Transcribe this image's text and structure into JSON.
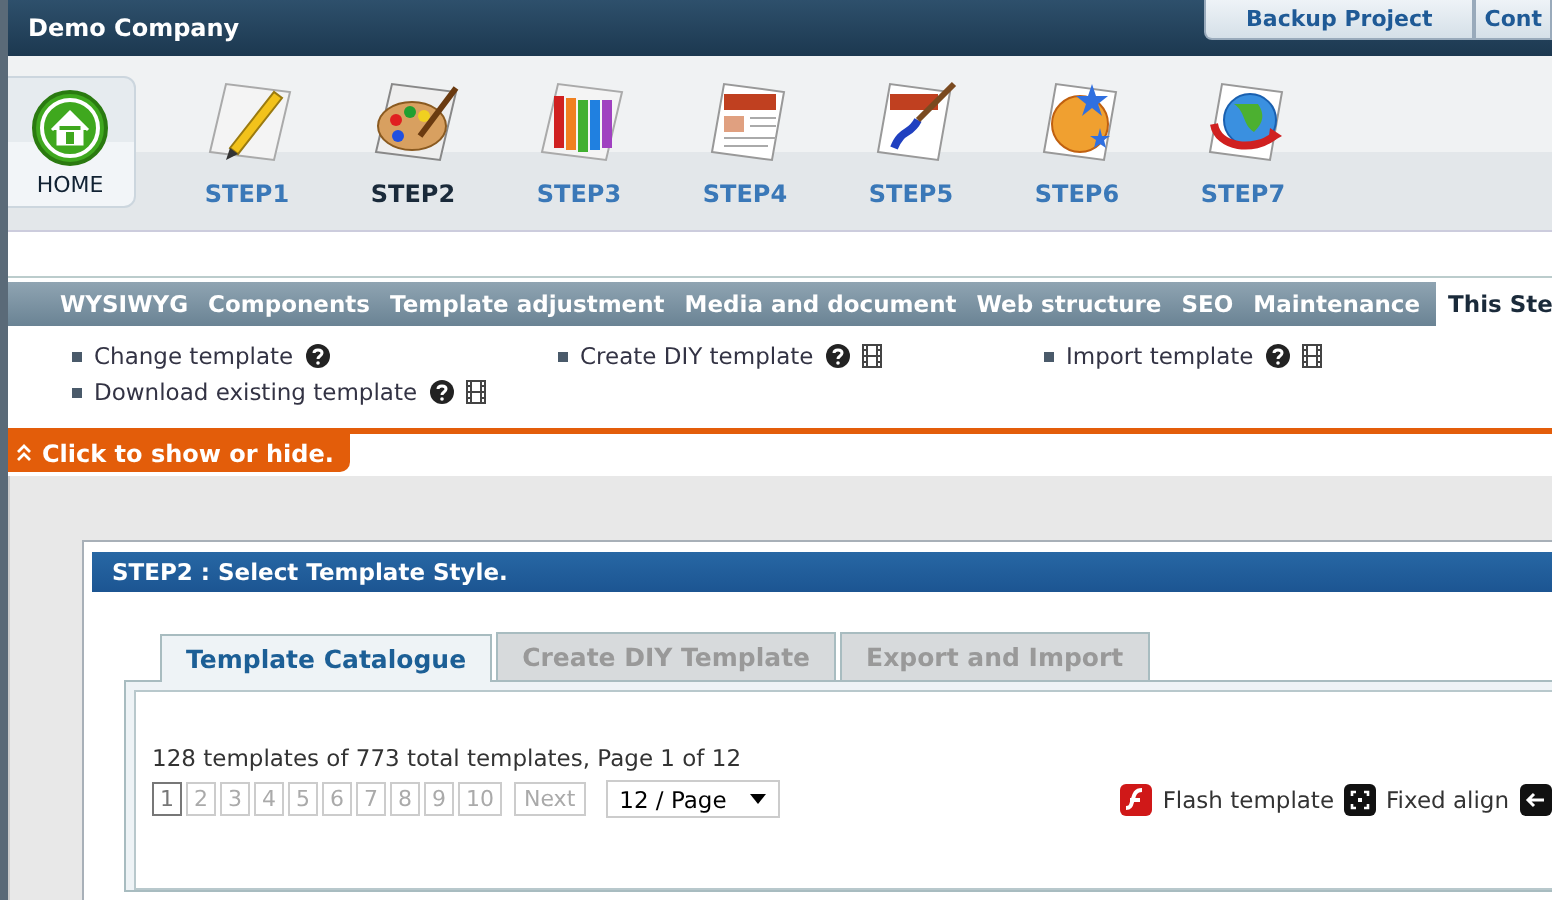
{
  "header": {
    "title": "Demo Company",
    "tabs": [
      "Backup Project",
      "Cont"
    ]
  },
  "home": {
    "label": "HOME"
  },
  "steps": [
    {
      "label": "STEP1",
      "selected": false,
      "kind": "pencil"
    },
    {
      "label": "STEP2",
      "selected": true,
      "kind": "palette"
    },
    {
      "label": "STEP3",
      "selected": false,
      "kind": "swatch"
    },
    {
      "label": "STEP4",
      "selected": false,
      "kind": "document"
    },
    {
      "label": "STEP5",
      "selected": false,
      "kind": "brush"
    },
    {
      "label": "STEP6",
      "selected": false,
      "kind": "stars"
    },
    {
      "label": "STEP7",
      "selected": false,
      "kind": "globe"
    }
  ],
  "menu": [
    {
      "label": "WYSIWYG",
      "selected": false
    },
    {
      "label": "Components",
      "selected": false
    },
    {
      "label": "Template adjustment",
      "selected": false
    },
    {
      "label": "Media and document",
      "selected": false
    },
    {
      "label": "Web structure",
      "selected": false
    },
    {
      "label": "SEO",
      "selected": false
    },
    {
      "label": "Maintenance",
      "selected": false
    },
    {
      "label": "This Ste",
      "selected": true
    }
  ],
  "links": [
    {
      "label": "Change template",
      "help": true,
      "video": false
    },
    {
      "label": "Create DIY template",
      "help": true,
      "video": true
    },
    {
      "label": "Import template",
      "help": true,
      "video": true
    },
    {
      "label": "Download existing template",
      "help": true,
      "video": true
    }
  ],
  "toggle": {
    "label": "Click to show or hide."
  },
  "panel": {
    "title": "STEP2 : Select Template Style.",
    "tabs": [
      {
        "label": "Template Catalogue",
        "selected": true
      },
      {
        "label": "Create DIY Template",
        "selected": false
      },
      {
        "label": "Export and Import",
        "selected": false
      }
    ],
    "summary": "128 templates of 773 total templates, Page 1 of 12",
    "pages": [
      {
        "label": "1",
        "selected": true
      },
      {
        "label": "2",
        "selected": false
      },
      {
        "label": "3",
        "selected": false
      },
      {
        "label": "4",
        "selected": false
      },
      {
        "label": "5",
        "selected": false
      },
      {
        "label": "6",
        "selected": false
      },
      {
        "label": "7",
        "selected": false
      },
      {
        "label": "8",
        "selected": false
      },
      {
        "label": "9",
        "selected": false
      },
      {
        "label": "10",
        "selected": false
      }
    ],
    "next": "Next",
    "per_page": "12 / Page",
    "legend": [
      {
        "kind": "flash",
        "label": "Flash template"
      },
      {
        "kind": "fixed",
        "label": "Fixed align"
      }
    ]
  }
}
